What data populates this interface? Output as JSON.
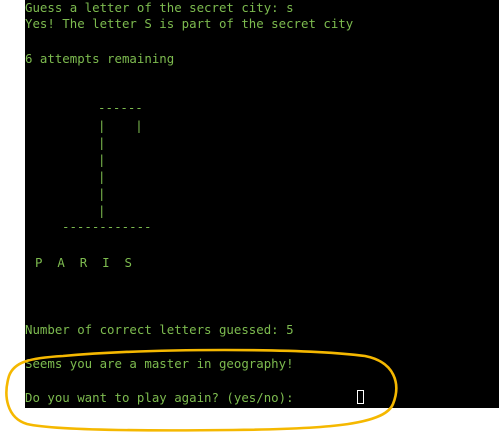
{
  "terminal": {
    "lines": {
      "guess_prompt": "Guess a letter of the secret city: s",
      "feedback": "Yes! The letter S is part of the secret city",
      "attempts": "6 attempts remaining",
      "gallows_top": "------",
      "gallows_rope": "|    |",
      "gallows_post_1": "|",
      "gallows_post_2": "|",
      "gallows_post_3": "|",
      "gallows_post_4": "|",
      "gallows_post_5": "|",
      "gallows_post_6": "|",
      "gallows_base": "------------",
      "word_display": "P  A  R  I  S",
      "correct_count": "Number of correct letters guessed: 5",
      "master_message": "Seems you are a master in geography!",
      "play_again_prompt": "Do you want to play again? (yes/no): "
    },
    "text_color": "#7dbb4f",
    "background": "#000000"
  },
  "annotation": {
    "color": "#f5b800",
    "shape": "hand-drawn ellipse"
  }
}
